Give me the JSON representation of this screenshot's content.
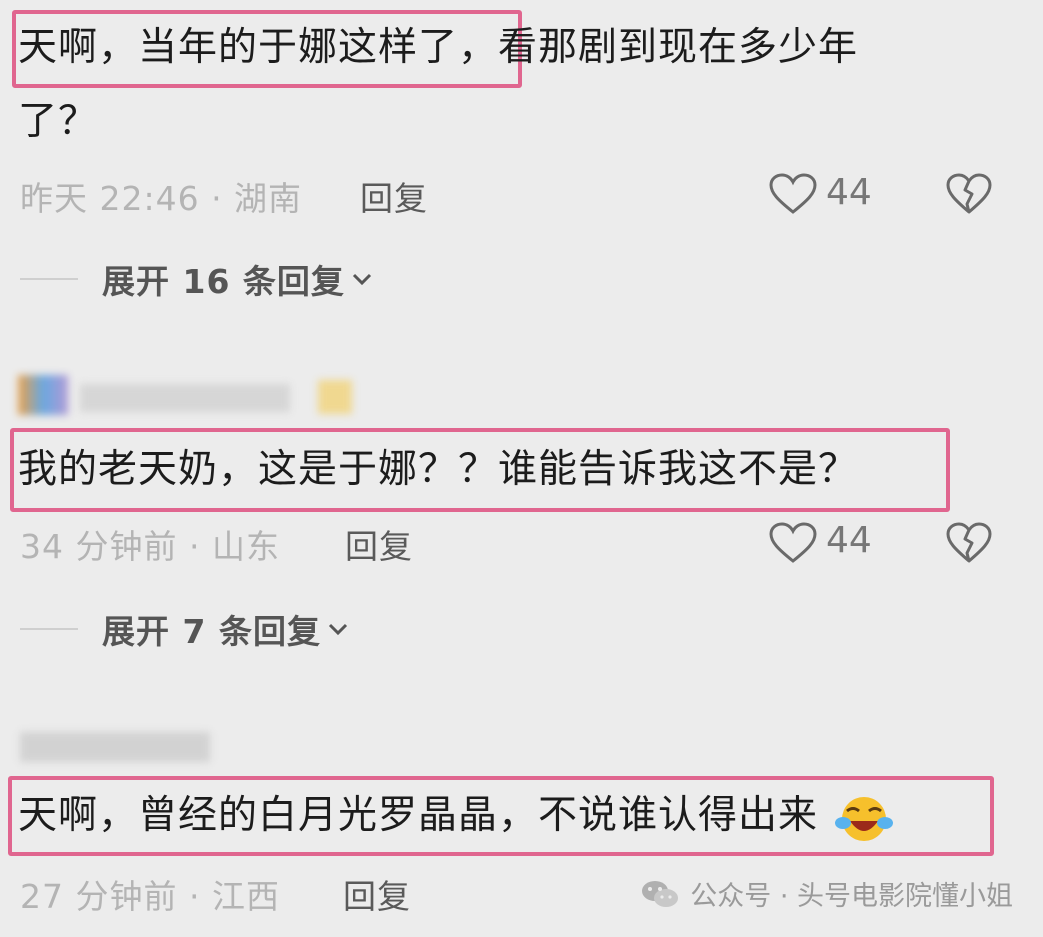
{
  "comments": [
    {
      "text_line1": "天啊，当年的于娜这样了，看那剧到现在多少年",
      "text_line2": "了？",
      "meta": "昨天 22:46 · 湖南",
      "reply": "回复",
      "likes": "44",
      "expand": "展开 16 条回复"
    },
    {
      "text": "我的老天奶，这是于娜？？谁能告诉我这不是？",
      "meta": "34 分钟前 · 山东",
      "reply": "回复",
      "likes": "44",
      "expand": "展开 7 条回复"
    },
    {
      "text": "天啊，曾经的白月光罗晶晶，不说谁认得出来",
      "meta": "27 分钟前 · 江西",
      "reply": "回复",
      "emoji": "laughing-crying-emoji"
    }
  ],
  "watermark": {
    "text": "公众号 · 头号电影院懂小姐",
    "icon": "wechat-icon"
  },
  "colors": {
    "highlight": "#e0668f",
    "background": "#ececec"
  }
}
